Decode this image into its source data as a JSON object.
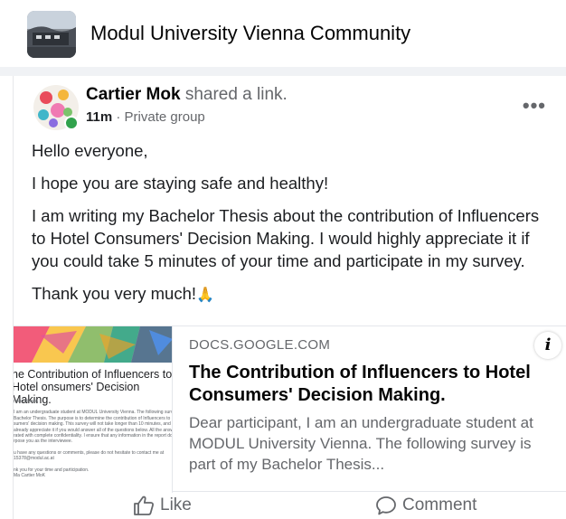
{
  "group": {
    "title": "Modul University Vienna Community",
    "thumb_icon": "group-cover-thumbnail"
  },
  "post": {
    "author": "Cartier Mok",
    "action": "shared a link.",
    "time": "11m",
    "separator": "·",
    "audience": "Private group",
    "more_icon": "more-options-icon",
    "body": [
      "Hello everyone,",
      "I hope you are staying safe and healthy!",
      "I am writing my Bachelor Thesis about the contribution of Influencers to Hotel Consumers' Decision Making. I would highly appreciate it if you could take 5 minutes of your time and participate in my survey.",
      "Thank you very much!"
    ],
    "thanks_emoji": "🙏"
  },
  "link": {
    "domain": "DOCS.GOOGLE.COM",
    "title": "The Contribution of Influencers to Hotel Consumers' Decision Making.",
    "description": "Dear participant, I am an undergraduate student at MODUL University Vienna. The following survey is part of my Bachelor Thesis...",
    "info_icon": "i",
    "thumb": {
      "title": "he Contribution of Influencers to Hotel onsumers' Decision Making.",
      "lines": [
        "r participant,",
        "I am an undergraduate student at MODUL University Vienna. The following survey is part",
        "Bachelor Thesis. The purpose is to determine the contribution of Influencers to Hotel",
        "sumers' decision making. This survey will not take longer than 10 minutes, and I woul",
        "already appreciate it if you would answer all of the questions below. All the answers",
        "rated with complete confidentiality. I ensure that any information in the report does no",
        "rpose you as the interviewee.",
        "",
        "u have any questions or comments, please do not hesitate to contact me at",
        "15378@modul.ac.at",
        "",
        "nk you for your time and participation.",
        "Ma Cartier MoK"
      ]
    }
  },
  "actions": {
    "like": "Like",
    "comment": "Comment"
  },
  "colors": {
    "secondary_text": "#65676b",
    "primary_text": "#050505",
    "online_badge": "#31a24c",
    "background_band": "#f0f2f5"
  }
}
